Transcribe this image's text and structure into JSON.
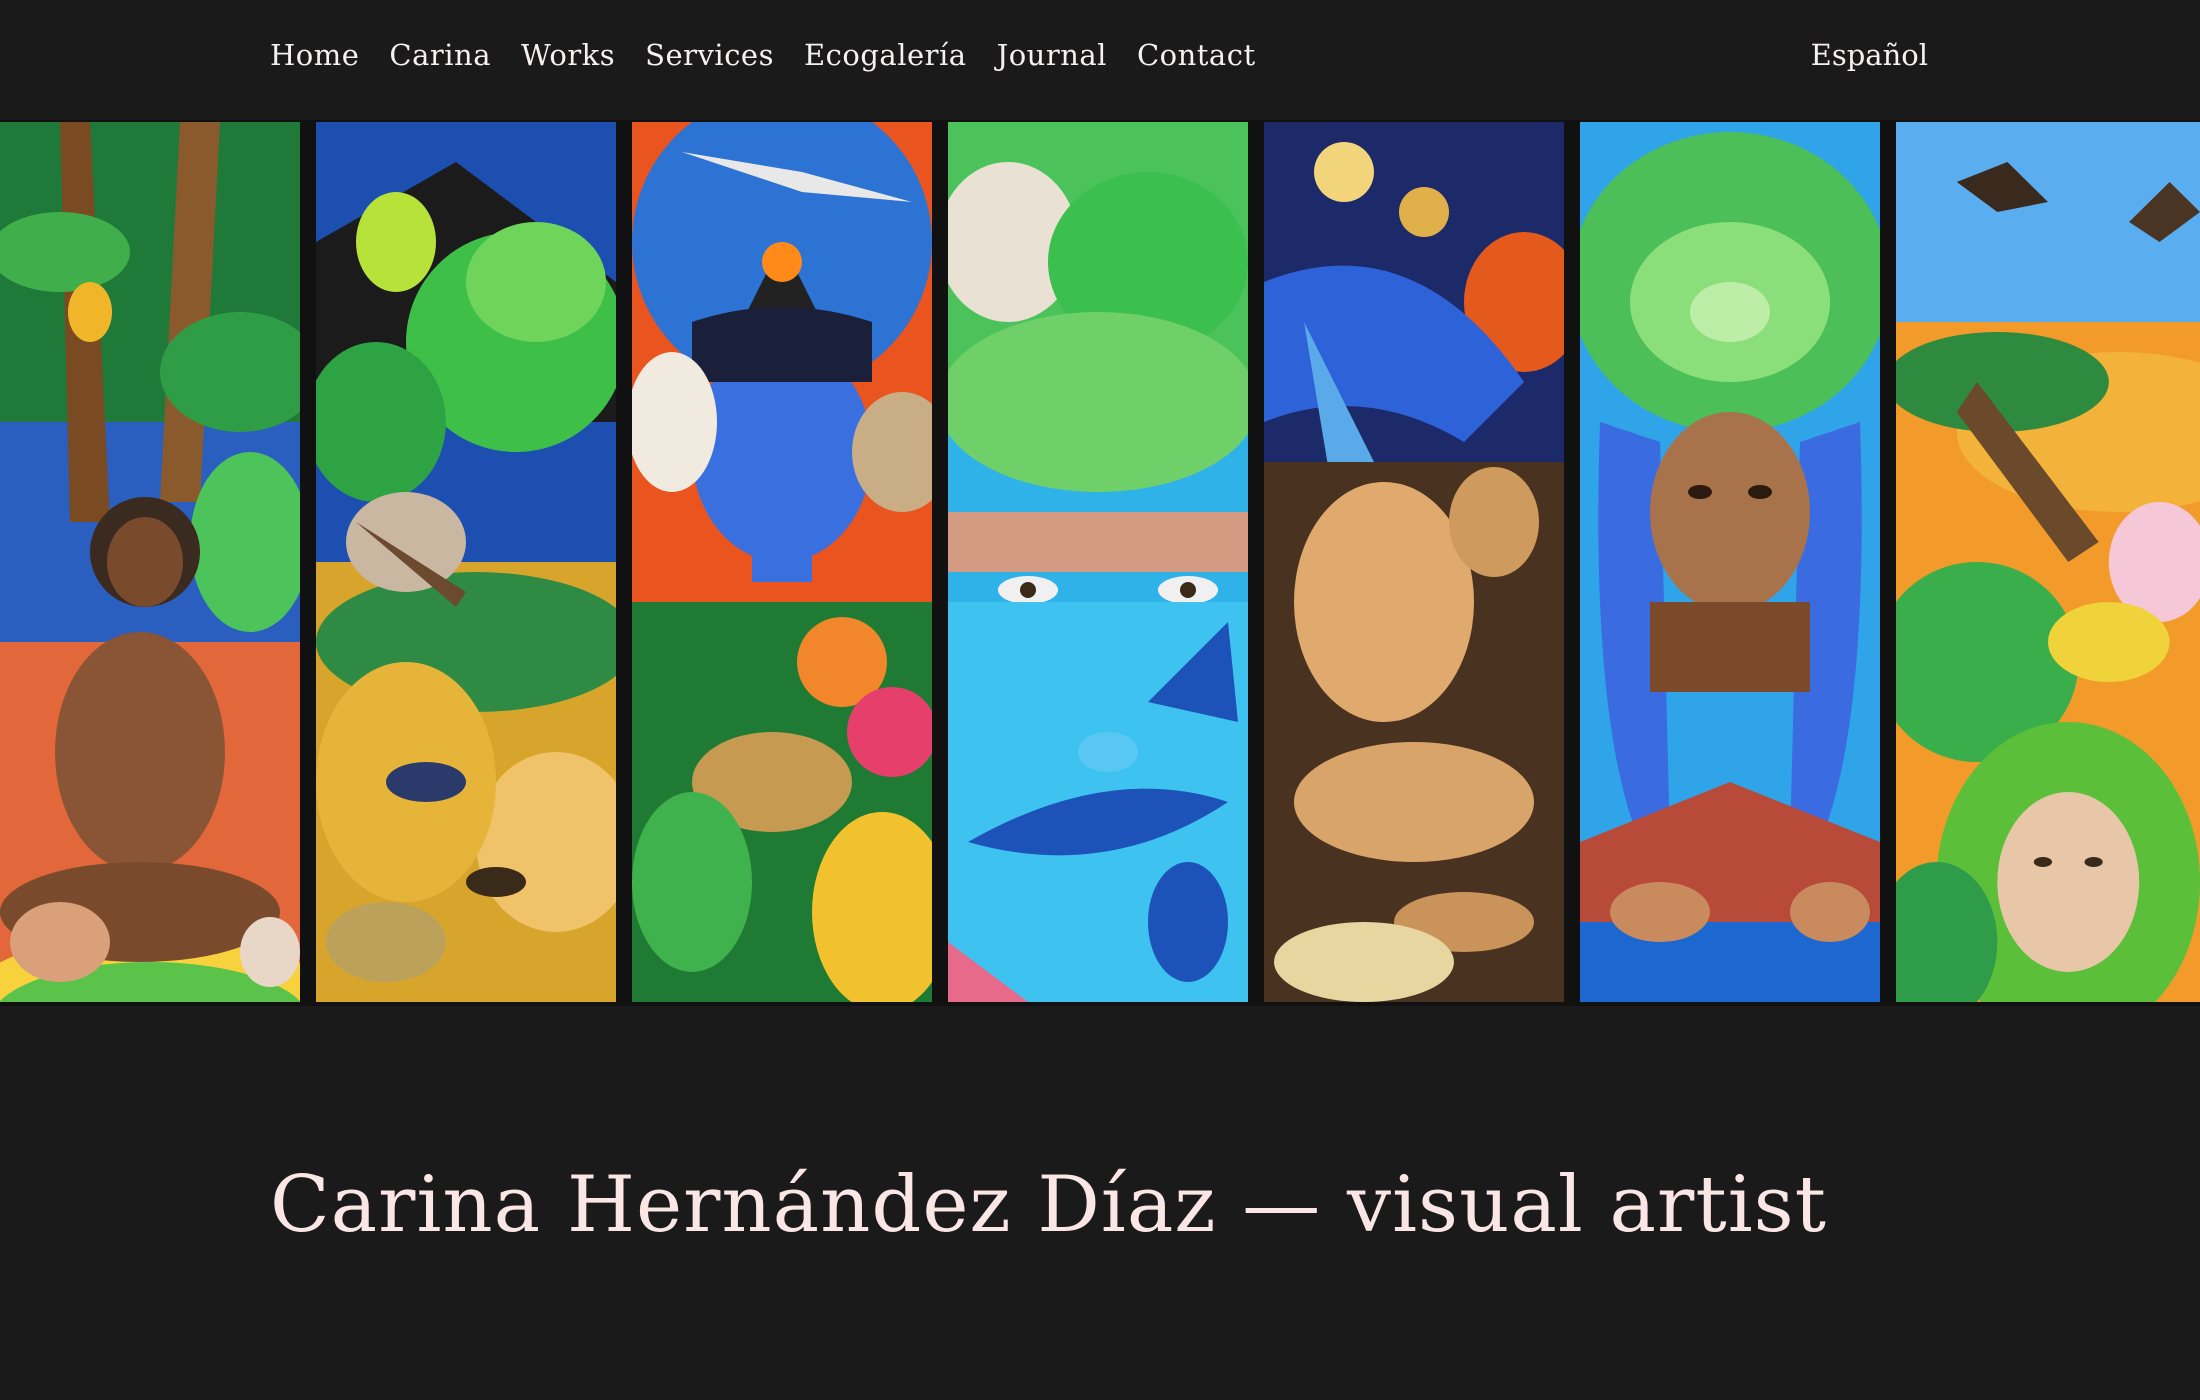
{
  "nav": {
    "items": [
      {
        "label": "Home"
      },
      {
        "label": "Carina"
      },
      {
        "label": "Works"
      },
      {
        "label": "Services"
      },
      {
        "label": "Ecogalería"
      },
      {
        "label": "Journal"
      },
      {
        "label": "Contact"
      }
    ],
    "language_label": "Español"
  },
  "gallery": {
    "panel_count": 7
  },
  "hero": {
    "title": "Carina Hernández Díaz — visual artist"
  },
  "colors": {
    "background": "#1a1a1b",
    "nav_text": "#f6f0f0",
    "title_text": "#fbe6e6"
  }
}
